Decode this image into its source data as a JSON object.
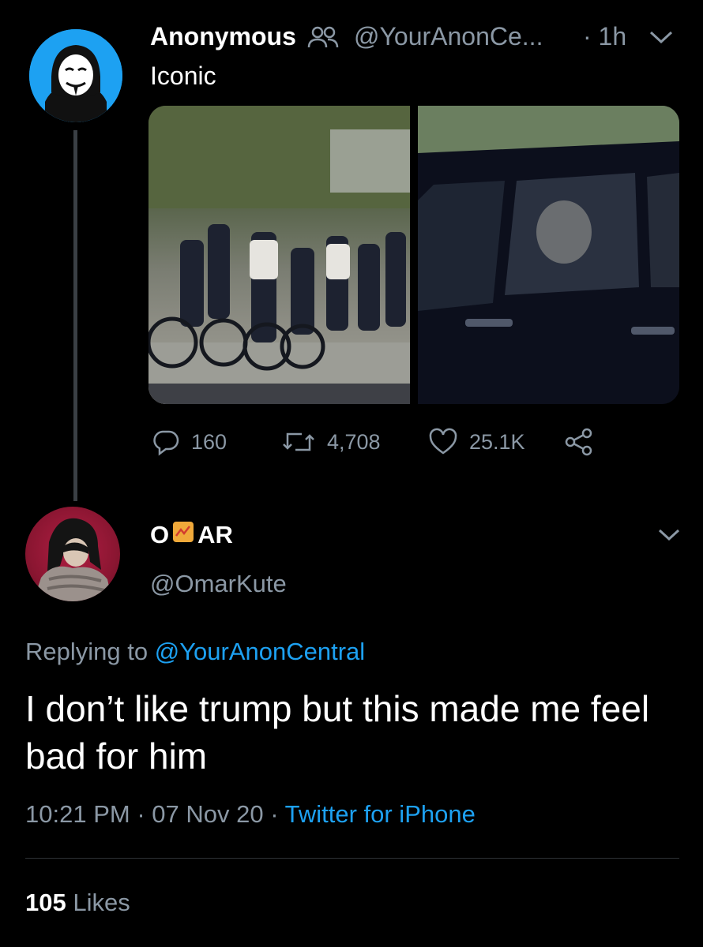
{
  "parent_tweet": {
    "display_name": "Anonymous",
    "handle": "@YourAnonCe...",
    "time": "· 1h",
    "text": "Iconic",
    "stats": {
      "replies": "160",
      "retweets": "4,708",
      "likes": "25.1K"
    }
  },
  "reply_tweet": {
    "display_name_prefix": "O",
    "display_name_suffix": "AR",
    "handle": "@OmarKute",
    "replying_prefix": "Replying to",
    "replying_to": "@YourAnonCentral",
    "text": "I don’t like trump but this made me feel bad for him",
    "time": "10:21 PM",
    "date": "07 Nov 20",
    "source": "Twitter for iPhone",
    "likes_count": "105",
    "likes_label": "Likes"
  },
  "colors": {
    "background": "#000000",
    "accent": "#1da1f2",
    "secondary_text": "#8b98a5",
    "divider": "#2f3336"
  },
  "icons": [
    "group-icon",
    "chevron-down-icon",
    "reply-icon",
    "retweet-icon",
    "like-icon",
    "share-icon"
  ]
}
